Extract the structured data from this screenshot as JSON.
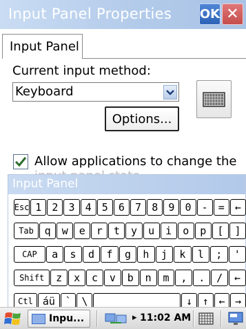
{
  "window": {
    "title": "Input Panel Properties",
    "ok_label": "OK",
    "close_label": "✕"
  },
  "tabs": [
    {
      "label": "Input Panel",
      "selected": true
    }
  ],
  "input_method": {
    "label": "Current input method:",
    "value": "Keyboard",
    "options_button": "Options..."
  },
  "allow_change": {
    "checked": true,
    "label": "Allow applications to change the",
    "label_obscured_continuation": "input panel state"
  },
  "input_panel": {
    "title": "Input Panel",
    "rows": [
      [
        {
          "l": "Esc",
          "w": 1
        },
        {
          "l": "1",
          "w": 1
        },
        {
          "l": "2",
          "w": 1
        },
        {
          "l": "3",
          "w": 1
        },
        {
          "l": "4",
          "w": 1
        },
        {
          "l": "5",
          "w": 1
        },
        {
          "l": "6",
          "w": 1
        },
        {
          "l": "7",
          "w": 1
        },
        {
          "l": "8",
          "w": 1
        },
        {
          "l": "9",
          "w": 1
        },
        {
          "l": "0",
          "w": 1
        },
        {
          "l": "-",
          "w": 1
        },
        {
          "l": "=",
          "w": 1
        },
        {
          "l": "←",
          "w": 1
        }
      ],
      [
        {
          "l": "Tab",
          "w": 1.5
        },
        {
          "l": "q",
          "w": 1
        },
        {
          "l": "w",
          "w": 1
        },
        {
          "l": "e",
          "w": 1
        },
        {
          "l": "r",
          "w": 1
        },
        {
          "l": "t",
          "w": 1
        },
        {
          "l": "y",
          "w": 1
        },
        {
          "l": "u",
          "w": 1
        },
        {
          "l": "i",
          "w": 1
        },
        {
          "l": "o",
          "w": 1
        },
        {
          "l": "p",
          "w": 1
        },
        {
          "l": "[",
          "w": 1
        },
        {
          "l": "]",
          "w": 1
        }
      ],
      [
        {
          "l": "CAP",
          "w": 1.8
        },
        {
          "l": "a",
          "w": 1
        },
        {
          "l": "s",
          "w": 1
        },
        {
          "l": "d",
          "w": 1
        },
        {
          "l": "f",
          "w": 1
        },
        {
          "l": "g",
          "w": 1
        },
        {
          "l": "h",
          "w": 1
        },
        {
          "l": "j",
          "w": 1
        },
        {
          "l": "k",
          "w": 1
        },
        {
          "l": "l",
          "w": 1
        },
        {
          "l": ";",
          "w": 1
        },
        {
          "l": "'",
          "w": 1
        }
      ],
      [
        {
          "l": "Shift",
          "w": 2.1
        },
        {
          "l": "z",
          "w": 1
        },
        {
          "l": "x",
          "w": 1
        },
        {
          "l": "c",
          "w": 1
        },
        {
          "l": "v",
          "w": 1
        },
        {
          "l": "b",
          "w": 1
        },
        {
          "l": "n",
          "w": 1
        },
        {
          "l": "m",
          "w": 1
        },
        {
          "l": ",",
          "w": 1
        },
        {
          "l": ".",
          "w": 1
        },
        {
          "l": "/",
          "w": 1
        },
        {
          "l": "←",
          "w": 1
        }
      ],
      [
        {
          "l": "Ctl",
          "w": 1.5
        },
        {
          "l": "áü",
          "w": 1.4
        },
        {
          "l": "`",
          "w": 1
        },
        {
          "l": "\\",
          "w": 1
        },
        {
          "l": "",
          "w": 5.6
        },
        {
          "l": "↓",
          "w": 1
        },
        {
          "l": "↑",
          "w": 1
        },
        {
          "l": "←",
          "w": 1
        },
        {
          "l": "→",
          "w": 1
        }
      ]
    ]
  },
  "taskbar": {
    "task_label": "Inpu...",
    "clock": "11:02 AM",
    "sync_arrow": "▸"
  },
  "icons": {
    "ok": "ok-icon",
    "close": "close-icon",
    "keyboard": "keyboard-icon",
    "dropdown": "chevron-down-icon",
    "check": "checkmark-icon",
    "start": "windows-flag-icon",
    "network": "network-sync-icon",
    "sip": "input-panel-icon",
    "desktop": "desktop-icon"
  },
  "colors": {
    "titlebar": "#b3cbea",
    "ok_button": "#2d62b7",
    "close_button": "#c54d4d",
    "checkmark": "#2e6c2b"
  }
}
